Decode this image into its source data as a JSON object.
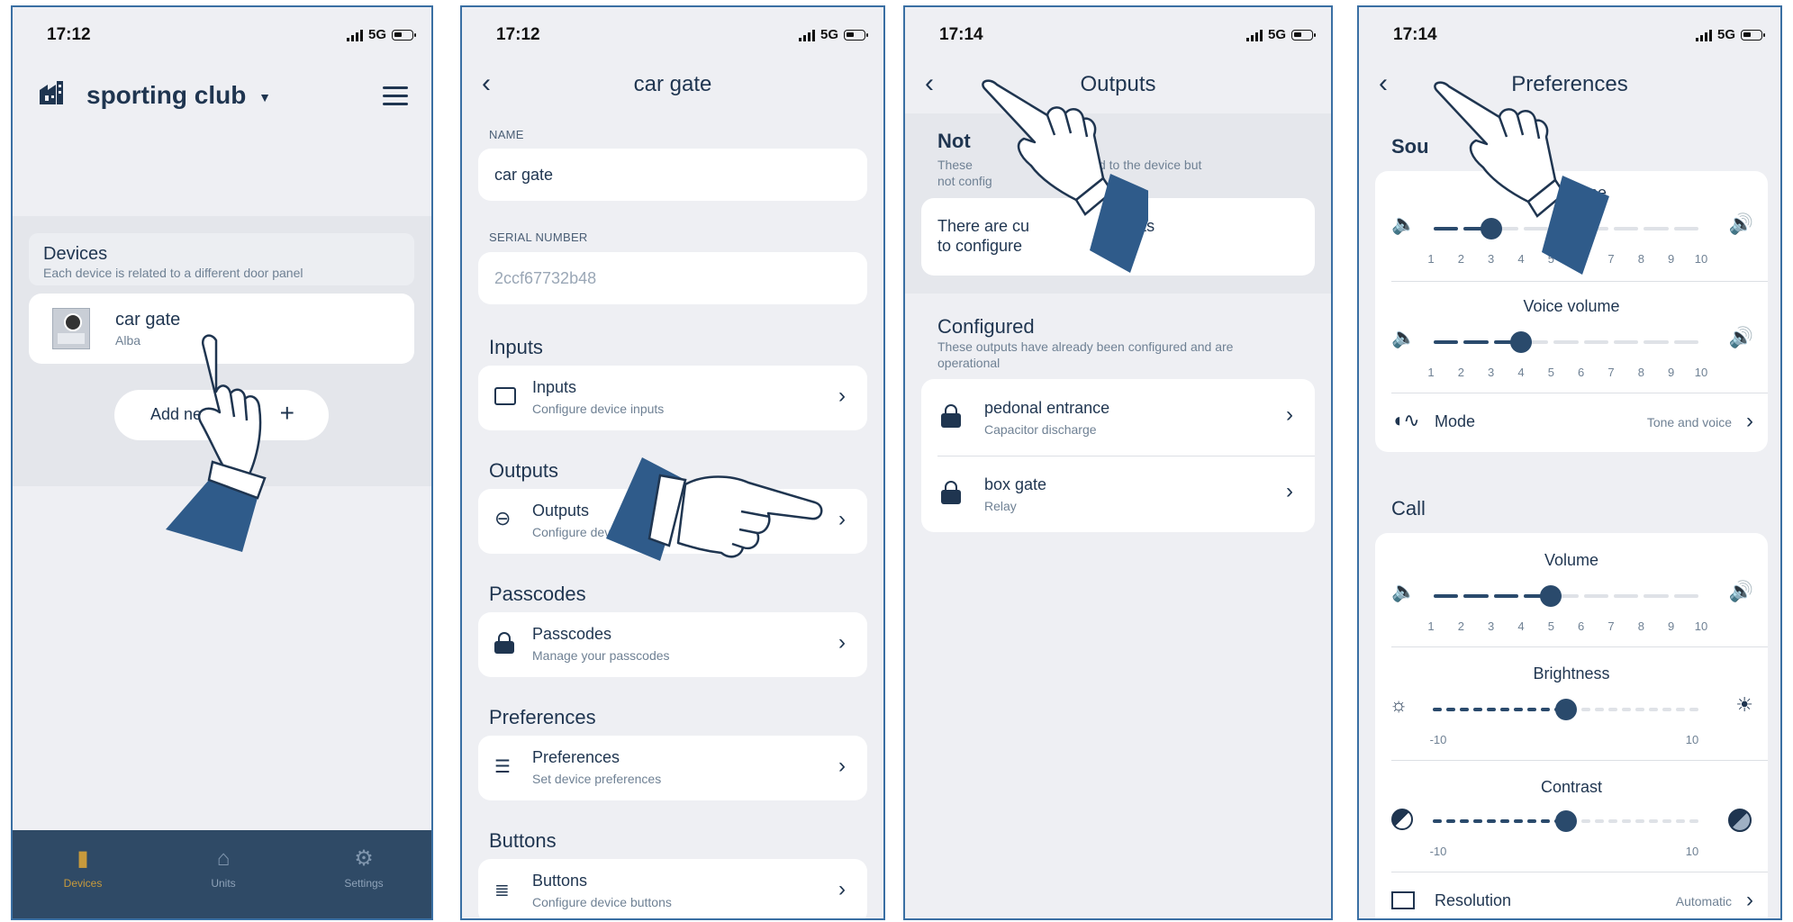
{
  "status": {
    "time1": "17:12",
    "time2": "17:12",
    "time3": "17:14",
    "time4": "17:14",
    "network": "5G"
  },
  "screen1": {
    "header_title": "sporting club",
    "devices_title": "Devices",
    "devices_sub": "Each device is related to a different door panel",
    "device_name": "car gate",
    "device_brand": "Alba",
    "add_label": "Add ne",
    "tabs": [
      {
        "label": "Devices",
        "icon": "door-panel-icon",
        "active": true
      },
      {
        "label": "Units",
        "icon": "home-icon",
        "active": false
      },
      {
        "label": "Settings",
        "icon": "gear-icon",
        "active": false
      }
    ]
  },
  "screen2": {
    "title": "car gate",
    "name_label": "NAME",
    "name_value": "car gate",
    "serial_label": "SERIAL NUMBER",
    "serial_value": "2ccf67732b48",
    "sections": [
      {
        "section": "Inputs",
        "title": "Inputs",
        "sub": "Configure device inputs",
        "icon": "input-panel-icon"
      },
      {
        "section": "Outputs",
        "title": "Outputs",
        "sub": "Configure dev",
        "icon": "plug-icon"
      },
      {
        "section": "Passcodes",
        "title": "Passcodes",
        "sub": "Manage your passcodes",
        "icon": "lock-keypad-icon"
      },
      {
        "section": "Preferences",
        "title": "Preferences",
        "sub": "Set device preferences",
        "icon": "sliders-icon"
      },
      {
        "section": "Buttons",
        "title": "Buttons",
        "sub": "Configure device buttons",
        "icon": "list-icon"
      }
    ]
  },
  "screen3": {
    "title": "Outputs",
    "not_configured_a": "Not",
    "not_configured_b": "d",
    "nc_sub_line1a": "These",
    "nc_sub_line1b": "nnected to the device but",
    "nc_sub_line2": "not config",
    "empty_a": "There are cu",
    "empty_b": "outputs",
    "empty_line2": "to configure",
    "configured_title": "Configured",
    "configured_sub": "These outputs have already been configured and are operational",
    "outputs": [
      {
        "name": "pedonal entrance",
        "type": "Capacitor discharge"
      },
      {
        "name": "box gate",
        "type": "Relay"
      }
    ]
  },
  "screen4": {
    "title": "Preferences",
    "sound_section": "Sou",
    "speaker_volume_label": "ume",
    "voice_volume_label": "Voice volume",
    "mode_label": "Mode",
    "mode_value": "Tone and voice",
    "call_section": "Call",
    "volume_label": "Volume",
    "brightness_label": "Brightness",
    "contrast_label": "Contrast",
    "resolution_label": "Resolution",
    "resolution_value": "Automatic",
    "ticks": [
      "1",
      "2",
      "3",
      "4",
      "5",
      "6",
      "7",
      "8",
      "9",
      "10"
    ],
    "range_min": "-10",
    "range_max": "10",
    "levels": {
      "sound_volume": 3,
      "voice_volume": 4,
      "call_volume": 5,
      "brightness_fraction": 0.5,
      "contrast_fraction": 0.5
    }
  },
  "colors": {
    "navy": "#1f3550",
    "accent": "#2f5b8a",
    "tabbar": "#2f4a66",
    "tab_active": "#c89a3c",
    "background": "#eeeff3"
  }
}
